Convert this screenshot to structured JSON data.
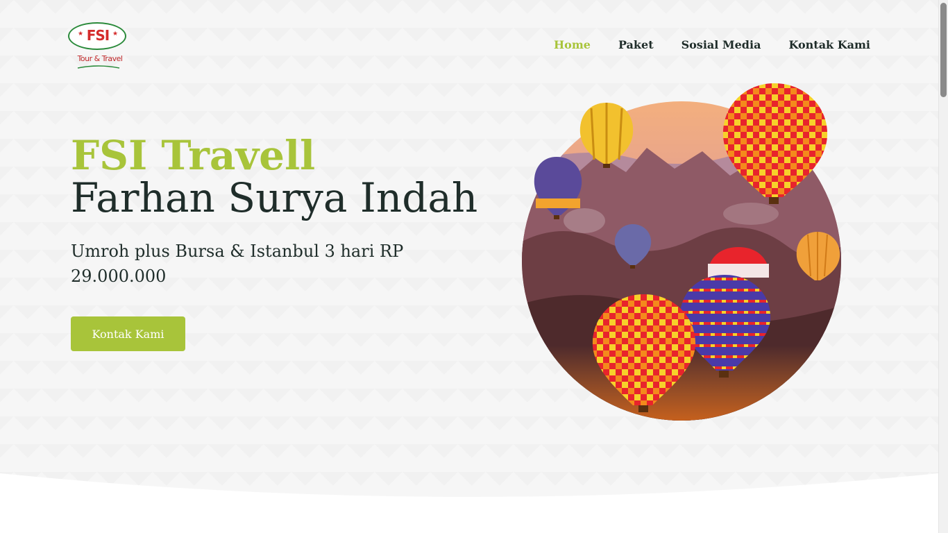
{
  "logo": {
    "text": "FSI",
    "subtitle": "Tour & Travel",
    "stars": [
      "★",
      "★"
    ]
  },
  "nav": {
    "items": [
      {
        "label": "Home",
        "active": true
      },
      {
        "label": "Paket",
        "active": false
      },
      {
        "label": "Sosial Media",
        "active": false
      },
      {
        "label": "Kontak Kami",
        "active": false
      }
    ]
  },
  "hero": {
    "title_line1": "FSI Travell",
    "title_line2": "Farhan Surya Indah",
    "subtitle": "Umroh plus Bursa & Istanbul 3 hari RP 29.000.000",
    "cta_label": "Kontak Kami",
    "image_icon": "hot-air-balloons-photo"
  },
  "colors": {
    "accent": "#a8c43a",
    "dark_text": "#1f2d2a",
    "background": "#f6f6f6",
    "logo_red": "#d42b2b",
    "logo_green": "#2a8a3a"
  }
}
